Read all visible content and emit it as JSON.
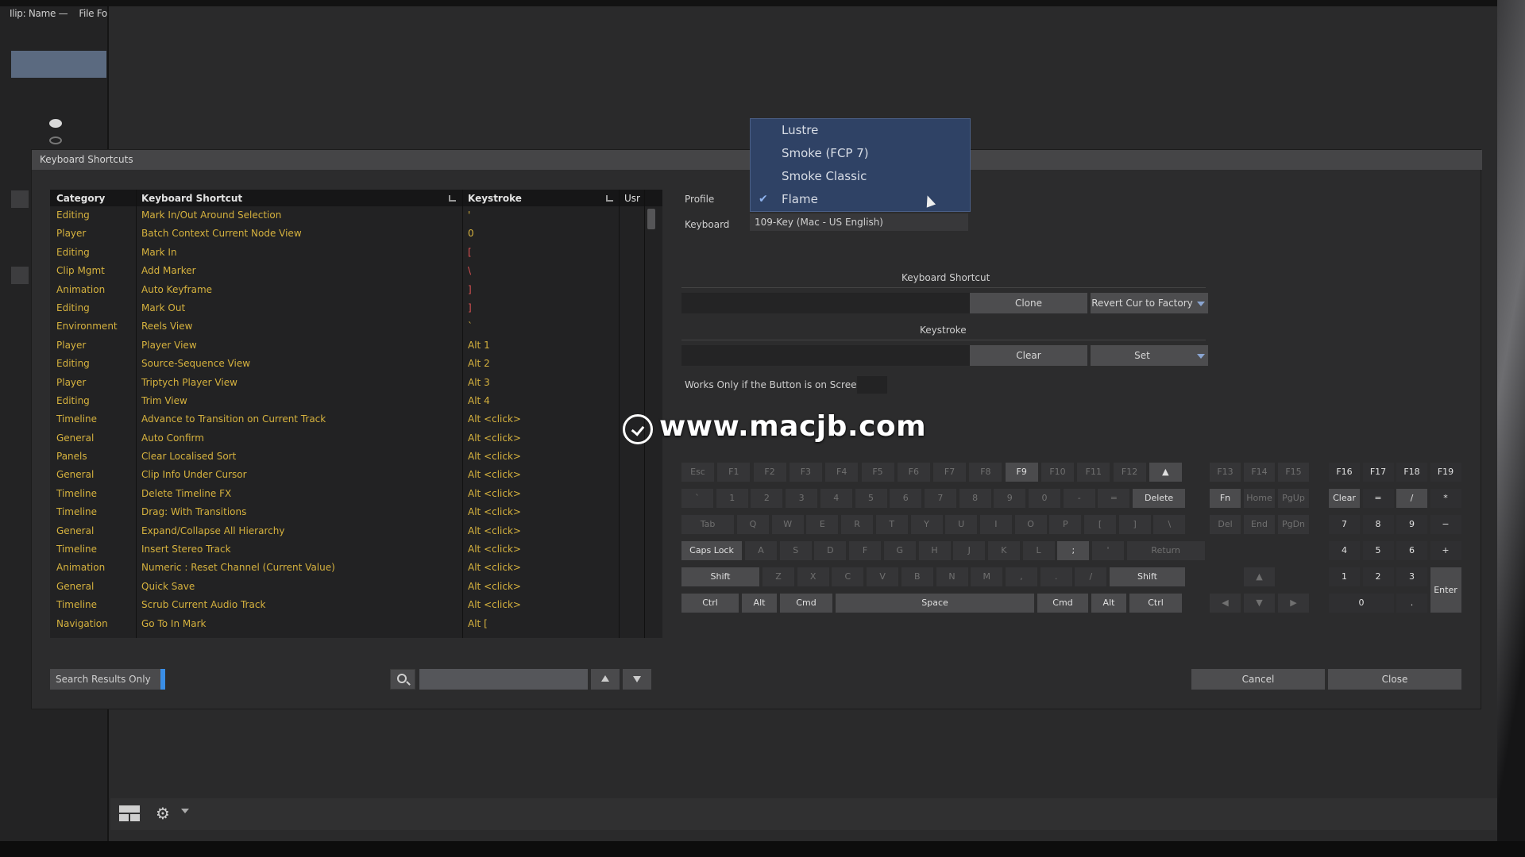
{
  "left_panel": {
    "header_a": "Ilip: Name —",
    "header_b": "File Fo"
  },
  "dialog": {
    "title": "Keyboard Shortcuts"
  },
  "table": {
    "headers": {
      "category": "Category",
      "shortcut": "Keyboard Shortcut",
      "keystroke": "Keystroke",
      "user": "Usr"
    },
    "rows": [
      {
        "category": "Editing",
        "shortcut": "Mark In/Out Around Selection",
        "keystroke": "'"
      },
      {
        "category": "Player",
        "shortcut": "Batch Context Current Node View",
        "keystroke": "0"
      },
      {
        "category": "Editing",
        "shortcut": "Mark In",
        "keystroke": "["
      },
      {
        "category": "Clip Mgmt",
        "shortcut": "Add Marker",
        "keystroke": "\\"
      },
      {
        "category": "Animation",
        "shortcut": "Auto Keyframe",
        "keystroke": "]"
      },
      {
        "category": "Editing",
        "shortcut": "Mark Out",
        "keystroke": "]"
      },
      {
        "category": "Environment",
        "shortcut": "Reels View",
        "keystroke": "`"
      },
      {
        "category": "Player",
        "shortcut": "Player View",
        "keystroke": "Alt  1"
      },
      {
        "category": "Editing",
        "shortcut": "Source-Sequence View",
        "keystroke": "Alt  2"
      },
      {
        "category": "Player",
        "shortcut": "Triptych Player View",
        "keystroke": "Alt  3"
      },
      {
        "category": "Editing",
        "shortcut": "Trim View",
        "keystroke": "Alt  4"
      },
      {
        "category": "Timeline",
        "shortcut": "Advance to Transition on Current Track",
        "keystroke": "Alt  <click>"
      },
      {
        "category": "General",
        "shortcut": "Auto Confirm",
        "keystroke": "Alt  <click>"
      },
      {
        "category": "Panels",
        "shortcut": "Clear Localised Sort",
        "keystroke": "Alt  <click>"
      },
      {
        "category": "General",
        "shortcut": "Clip Info Under Cursor",
        "keystroke": "Alt  <click>"
      },
      {
        "category": "Timeline",
        "shortcut": "Delete Timeline FX",
        "keystroke": "Alt  <click>"
      },
      {
        "category": "Timeline",
        "shortcut": "Drag: With Transitions",
        "keystroke": "Alt  <click>"
      },
      {
        "category": "General",
        "shortcut": "Expand/Collapse All Hierarchy",
        "keystroke": "Alt  <click>"
      },
      {
        "category": "Timeline",
        "shortcut": "Insert Stereo Track",
        "keystroke": "Alt  <click>"
      },
      {
        "category": "Animation",
        "shortcut": "Numeric : Reset Channel (Current Value)",
        "keystroke": "Alt  <click>"
      },
      {
        "category": "General",
        "shortcut": "Quick Save",
        "keystroke": "Alt  <click>"
      },
      {
        "category": "Timeline",
        "shortcut": "Scrub Current Audio Track",
        "keystroke": "Alt  <click>"
      },
      {
        "category": "Navigation",
        "shortcut": "Go To In Mark",
        "keystroke": "Alt  ["
      }
    ]
  },
  "search": {
    "results_only": "Search Results Only",
    "value": ""
  },
  "profile": {
    "label": "Profile",
    "options": [
      "Lustre",
      "Smoke (FCP 7)",
      "Smoke Classic",
      "Flame"
    ],
    "selected": "Flame",
    "keyboard_label": "Keyboard",
    "keyboard_value": "109-Key (Mac - US English)"
  },
  "shortcut_section": {
    "title": "Keyboard Shortcut",
    "clone": "Clone",
    "revert": "Revert Cur to Factory"
  },
  "keystroke_section": {
    "title": "Keystroke",
    "clear": "Clear",
    "set": "Set",
    "works_only": "Works Only if the Button is on Screen"
  },
  "keyboard": {
    "row_fn": [
      "Esc",
      "F1",
      "F2",
      "F3",
      "F4",
      "F5",
      "F6",
      "F7",
      "F8",
      "F9",
      "F10",
      "F11",
      "F12",
      "▲"
    ],
    "row_num": [
      "`",
      "1",
      "2",
      "3",
      "4",
      "5",
      "6",
      "7",
      "8",
      "9",
      "0",
      "-",
      "=",
      "Delete"
    ],
    "row_q": [
      "Tab",
      "Q",
      "W",
      "E",
      "R",
      "T",
      "Y",
      "U",
      "I",
      "O",
      "P",
      "[",
      "]",
      "\\"
    ],
    "row_a": [
      "Caps Lock",
      "A",
      "S",
      "D",
      "F",
      "G",
      "H",
      "J",
      "K",
      "L",
      ";",
      "'",
      "Return"
    ],
    "row_z": [
      "Shift",
      "Z",
      "X",
      "C",
      "V",
      "B",
      "N",
      "M",
      ",",
      ".",
      "/",
      "Shift"
    ],
    "row_ctrl": [
      "Ctrl",
      "Alt",
      "Cmd",
      "Space",
      "Cmd",
      "Alt",
      "Ctrl"
    ],
    "nav_fn": [
      "F13",
      "F14",
      "F15"
    ],
    "nav_1": [
      "Fn",
      "Home",
      "PgUp"
    ],
    "nav_2": [
      "Del",
      "End",
      "PgDn"
    ],
    "arrows": [
      "▲",
      "◀",
      "▼",
      "▶"
    ],
    "numpad_fn": [
      "F16",
      "F17",
      "F18",
      "F19"
    ],
    "numpad": [
      "Clear",
      "=",
      "/",
      "*",
      "7",
      "8",
      "9",
      "−",
      "4",
      "5",
      "6",
      "+",
      "1",
      "2",
      "3",
      "Enter",
      "0",
      "."
    ]
  },
  "footer": {
    "cancel": "Cancel",
    "close": "Close"
  },
  "watermark": "www.macjb.com"
}
